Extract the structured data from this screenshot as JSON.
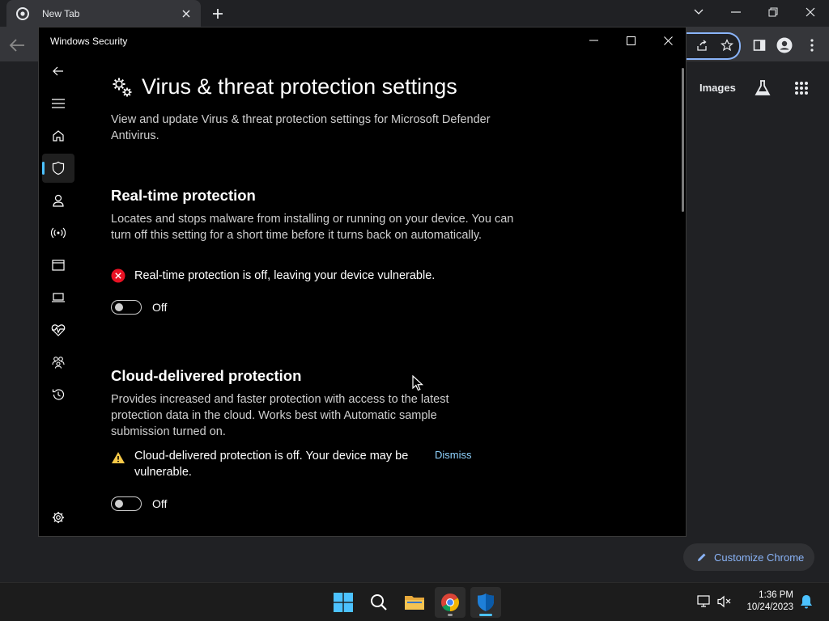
{
  "chrome": {
    "tab_title": "New Tab",
    "images_link": "Images",
    "customize_label": "Customize Chrome"
  },
  "window": {
    "title": "Windows Security"
  },
  "page": {
    "title": "Virus & threat protection settings",
    "description": "View and update Virus & threat protection settings for Microsoft Defender Antivirus."
  },
  "nav": {
    "items": [
      "back",
      "menu",
      "home",
      "virus-threat-protection",
      "account-protection",
      "firewall-network",
      "app-browser-control",
      "device-security",
      "device-performance-health",
      "family-options",
      "protection-history",
      "settings"
    ],
    "active": "virus-threat-protection"
  },
  "realtime": {
    "title": "Real-time protection",
    "description": "Locates and stops malware from installing or running on your device. You can turn off this setting for a short time before it turns back on automatically.",
    "status": "Real-time protection is off, leaving your device vulnerable.",
    "toggle_state": "Off"
  },
  "cloud": {
    "title": "Cloud-delivered protection",
    "description": "Provides increased and faster protection with access to the latest protection data in the cloud. Works best with Automatic sample submission turned on.",
    "status": "Cloud-delivered protection is off. Your device may be vulnerable.",
    "dismiss": "Dismiss",
    "toggle_state": "Off"
  },
  "taskbar": {
    "time": "1:36 PM",
    "date": "10/24/2023"
  },
  "colors": {
    "accent": "#4cc2ff",
    "error": "#e81123",
    "warning": "#f7c948",
    "link": "#8fd3ff"
  }
}
